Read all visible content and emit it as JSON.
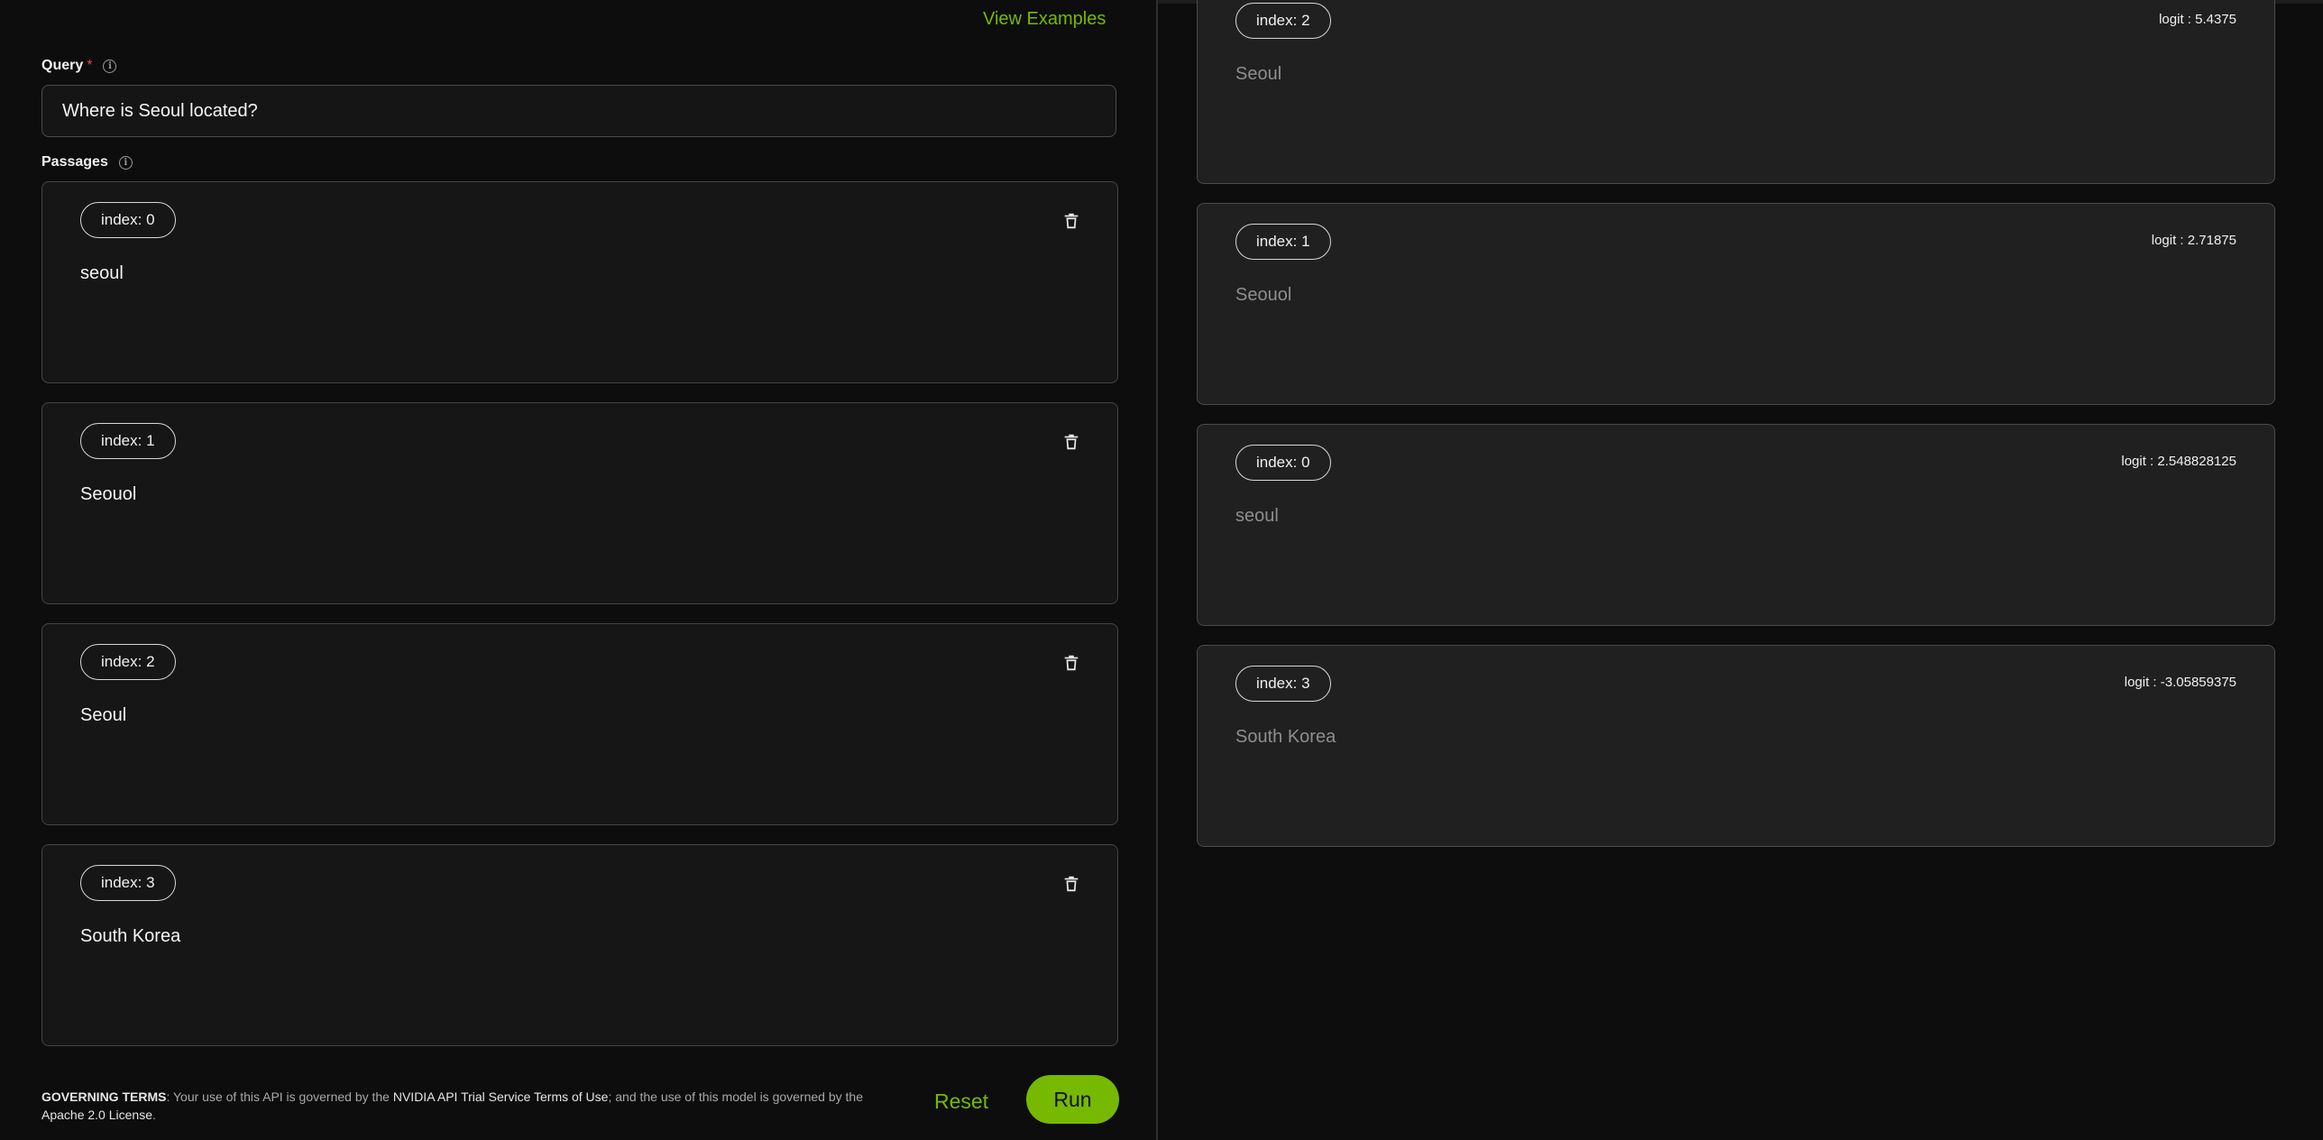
{
  "header": {
    "view_examples": "View Examples"
  },
  "query": {
    "label": "Query",
    "required_mark": "*",
    "value": "Where is Seoul located?"
  },
  "passages": {
    "label": "Passages",
    "items": [
      {
        "index": "index: 0",
        "text": "seoul"
      },
      {
        "index": "index: 1",
        "text": "Seouol"
      },
      {
        "index": "index: 2",
        "text": "Seoul"
      },
      {
        "index": "index: 3",
        "text": "South Korea"
      }
    ]
  },
  "results": {
    "items": [
      {
        "index": "index: 2",
        "logit": "logit : 5.4375",
        "text": "Seoul"
      },
      {
        "index": "index: 1",
        "logit": "logit : 2.71875",
        "text": "Seouol"
      },
      {
        "index": "index: 0",
        "logit": "logit : 2.548828125",
        "text": "seoul"
      },
      {
        "index": "index: 3",
        "logit": "logit : -3.05859375",
        "text": "South Korea"
      }
    ]
  },
  "footer": {
    "governing_title": "GOVERNING TERMS",
    "governing_text_1": ": Your use of this API is governed by the ",
    "governing_link_1": "NVIDIA API Trial Service Terms of Use",
    "governing_text_2": "; and the use of this model is governed by the ",
    "governing_link_2": "Apache 2.0 License",
    "governing_text_3": ".",
    "reset_label": "Reset",
    "run_label": "Run"
  },
  "colors": {
    "accent": "#76b900",
    "background": "#0c0c0c",
    "required": "#e04a4a"
  }
}
